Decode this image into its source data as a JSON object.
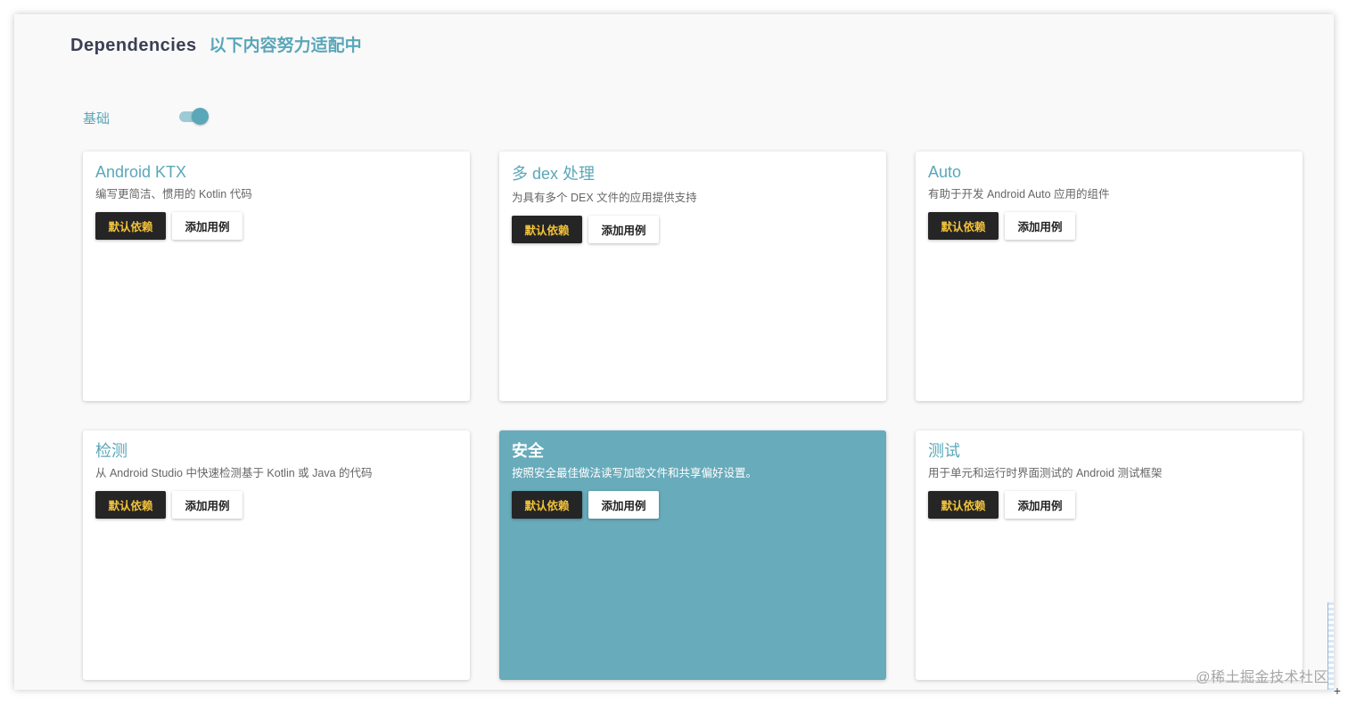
{
  "header": {
    "title": "Dependencies",
    "subtitle": "以下内容努力适配中"
  },
  "section": {
    "label": "基础",
    "toggle_on": true,
    "toggle_color": "#5aa7b9"
  },
  "buttons": {
    "default_dependency": "默认依赖",
    "add_example": "添加用例"
  },
  "cards": [
    {
      "title": "Android KTX",
      "description": "编写更简洁、惯用的 Kotlin 代码",
      "highlighted": false
    },
    {
      "title": "多 dex 处理",
      "description": "为具有多个 DEX 文件的应用提供支持",
      "highlighted": false
    },
    {
      "title": "Auto",
      "description": "有助于开发 Android Auto 应用的组件",
      "highlighted": false
    },
    {
      "title": "检测",
      "description": "从 Android Studio 中快速检测基于 Kotlin 或 Java 的代码",
      "highlighted": false
    },
    {
      "title": "安全",
      "description": "按照安全最佳做法读写加密文件和共享偏好设置。",
      "highlighted": true
    },
    {
      "title": "测试",
      "description": "用于单元和运行时界面测试的 Android 测试框架",
      "highlighted": false
    }
  ],
  "colors": {
    "accent": "#5aa7b9",
    "highlight_card": "#68abbb",
    "dark_button": "#252525",
    "dark_button_text": "#f2c23a",
    "title_text": "#3b3f54"
  },
  "watermark": "@稀土掘金技术社区"
}
